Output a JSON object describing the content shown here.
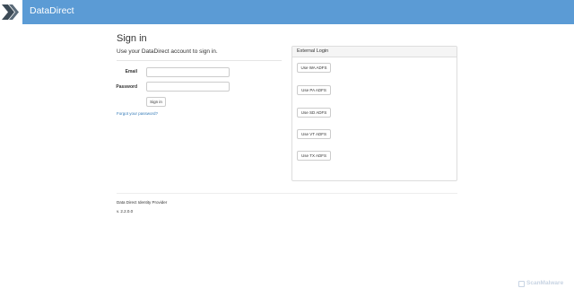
{
  "navbar": {
    "brand": "DataDirect",
    "logo_icon": "chevron-arrows-logo-icon",
    "colors": {
      "bar": "#5b9bd5",
      "logo": "#3d4b57"
    }
  },
  "signin": {
    "title": "Sign in",
    "subtitle": "Use your DataDirect account to sign in.",
    "email_label": "Email",
    "email_value": "",
    "password_label": "Password",
    "password_value": "",
    "submit_label": "Sign in",
    "forgot_link": "Forgot your password?"
  },
  "external": {
    "heading": "External Login",
    "providers": [
      "Use WA ADFS",
      "Use PA ADFS",
      "Use SD ADFS",
      "Use VT ADFS",
      "Use TX ADFS"
    ]
  },
  "footer": {
    "name": "Data Direct Identity Provider",
    "version": "v. 2.2.0.0"
  },
  "watermark": {
    "text": "ScanMalware"
  }
}
